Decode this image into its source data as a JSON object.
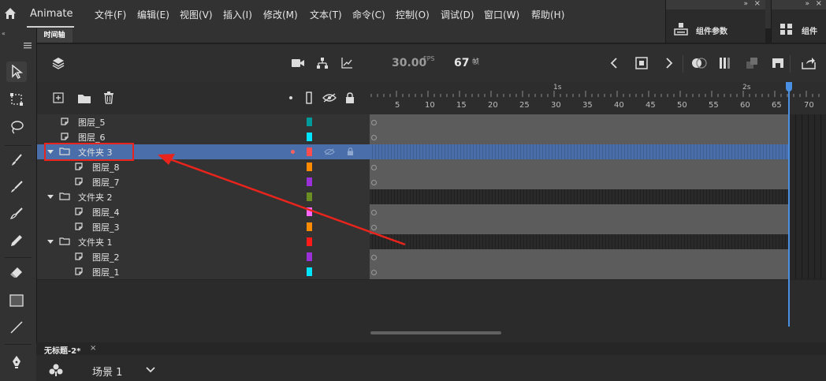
{
  "app": {
    "name": "Animate"
  },
  "menu": [
    "文件(F)",
    "编辑(E)",
    "视图(V)",
    "插入(I)",
    "修改(M)",
    "文本(T)",
    "命令(C)",
    "控制(O)",
    "调试(D)",
    "窗口(W)",
    "帮助(H)"
  ],
  "panels": {
    "component_params": "组件参数",
    "components": "组件"
  },
  "timeline": {
    "tab_label": "时间轴",
    "fps": "30.00",
    "fps_unit": "FPS",
    "current_frame": "67",
    "frame_unit": "帧",
    "ruler_seconds": [
      "1s",
      "2s"
    ],
    "ruler_ticks": [
      "5",
      "10",
      "15",
      "20",
      "25",
      "30",
      "35",
      "40",
      "45",
      "50",
      "55",
      "60",
      "65",
      "70"
    ]
  },
  "layers": [
    {
      "name": "图层_5",
      "type": "layer",
      "indent": 0,
      "color": "#009a9a"
    },
    {
      "name": "图层_6",
      "type": "layer",
      "indent": 0,
      "color": "#00e5ff"
    },
    {
      "name": "文件夹 3",
      "type": "folder",
      "indent": 0,
      "color": "#ff4d4d",
      "selected": true
    },
    {
      "name": "图层_8",
      "type": "layer",
      "indent": 1,
      "color": "#ff8c00"
    },
    {
      "name": "图层_7",
      "type": "layer",
      "indent": 1,
      "color": "#9b30d9"
    },
    {
      "name": "文件夹 2",
      "type": "folder",
      "indent": 0,
      "color": "#6b8e23"
    },
    {
      "name": "图层_4",
      "type": "layer",
      "indent": 1,
      "color": "#ff66ff"
    },
    {
      "name": "图层_3",
      "type": "layer",
      "indent": 1,
      "color": "#ff8c00"
    },
    {
      "name": "文件夹 1",
      "type": "folder",
      "indent": 0,
      "color": "#ff1a1a"
    },
    {
      "name": "图层_2",
      "type": "layer",
      "indent": 1,
      "color": "#9b30d9"
    },
    {
      "name": "图层_1",
      "type": "layer",
      "indent": 1,
      "color": "#00e5ff"
    }
  ],
  "document": {
    "tab": "无标题-2*",
    "close": "×",
    "scene": "场景 1"
  },
  "colors": {
    "selection": "#4a6ea9",
    "playhead": "#4a90e2",
    "annotation": "#e8241c"
  }
}
